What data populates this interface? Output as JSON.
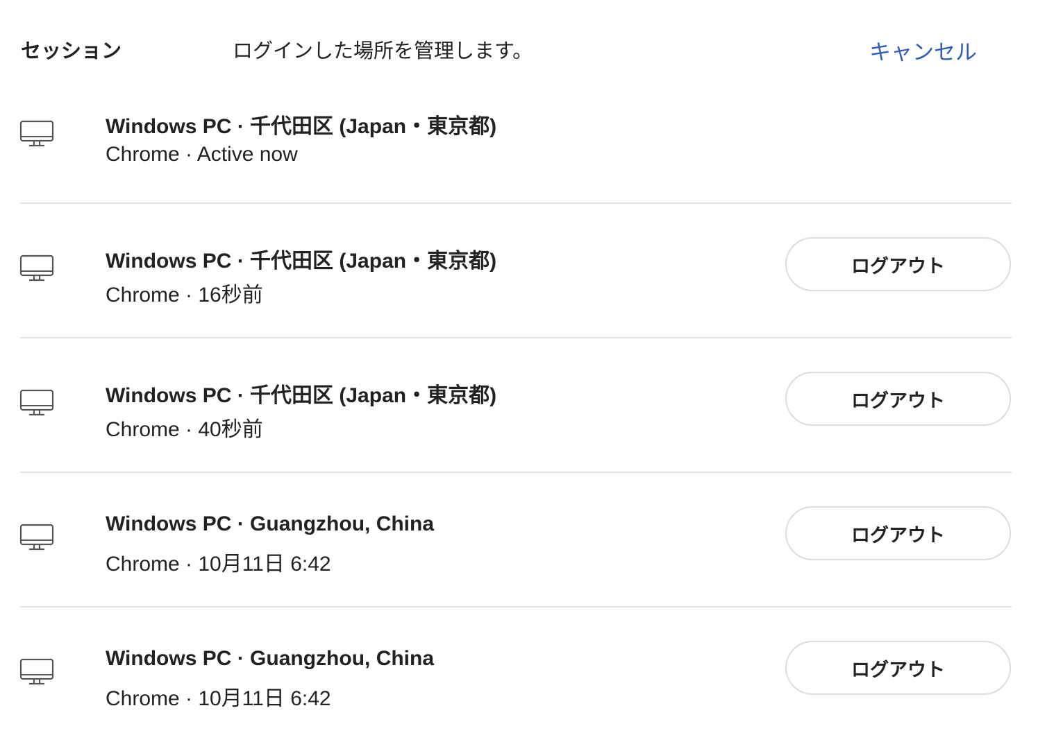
{
  "header": {
    "title": "セッション",
    "description": "ログインした場所を管理します。",
    "cancel_label": "キャンセル"
  },
  "sessions": [
    {
      "device": "Windows PC · 千代田区 (Japan・東京都)",
      "detail": "Chrome · Active now",
      "logout_label": ""
    },
    {
      "device": "Windows PC · 千代田区 (Japan・東京都)",
      "detail": "Chrome · 16秒前",
      "logout_label": "ログアウト"
    },
    {
      "device": "Windows PC · 千代田区 (Japan・東京都)",
      "detail": "Chrome · 40秒前",
      "logout_label": "ログアウト"
    },
    {
      "device": "Windows PC · Guangzhou, China",
      "detail": "Chrome · 10月11日 6:42",
      "logout_label": "ログアウト"
    },
    {
      "device": "Windows PC · Guangzhou, China",
      "detail": "Chrome · 10月11日 6:42",
      "logout_label": "ログアウト"
    }
  ],
  "icons": {
    "device": "desktop-monitor-icon"
  },
  "colors": {
    "accent": "#2f5db8",
    "divider": "#e1e1e1",
    "button_border": "#dcdcdc"
  }
}
